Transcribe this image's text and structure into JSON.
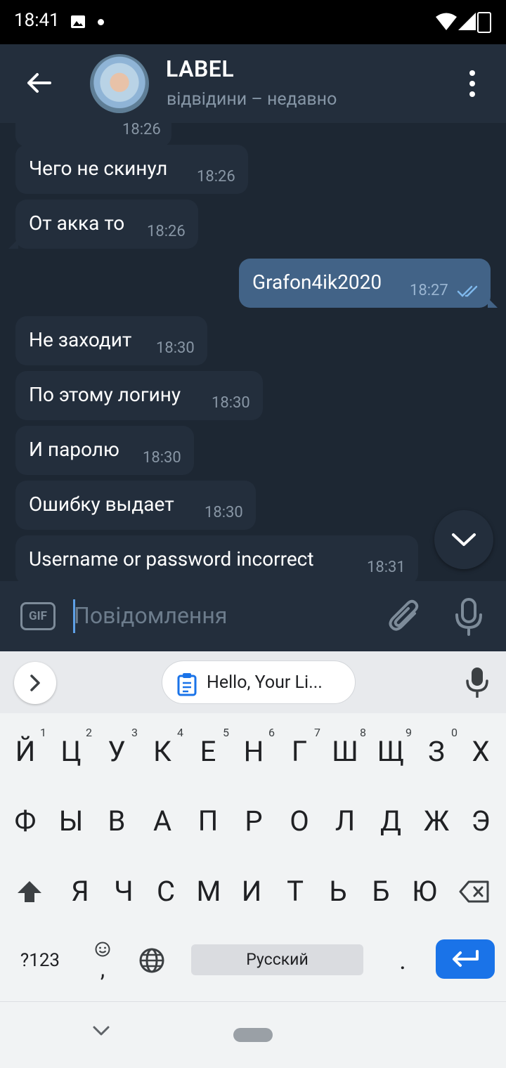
{
  "status_bar": {
    "time": "18:41"
  },
  "header": {
    "title": "LABEL",
    "status": "відвідини – недавно"
  },
  "messages": [
    {
      "text": "Чего не скинул",
      "time": "18:26",
      "direction": "in"
    },
    {
      "text": "От акка то",
      "time": "18:26",
      "direction": "in"
    },
    {
      "text": "Grafon4ik2020",
      "time": "18:27",
      "direction": "out",
      "read": true
    },
    {
      "text": "Не заходит",
      "time": "18:30",
      "direction": "in"
    },
    {
      "text": "По этому логину",
      "time": "18:30",
      "direction": "in"
    },
    {
      "text": "И паролю",
      "time": "18:30",
      "direction": "in"
    },
    {
      "text": "Ошибку выдает",
      "time": "18:30",
      "direction": "in"
    },
    {
      "text": "Username or password incorrect",
      "time": "18:31",
      "direction": "in"
    }
  ],
  "partial_message": {
    "time": "18:26"
  },
  "composer": {
    "gif_label": "GIF",
    "placeholder": "Повідомлення"
  },
  "keyboard": {
    "clipboard_chip": "Hello, Your Li...",
    "row1": [
      "Й",
      "Ц",
      "У",
      "К",
      "Е",
      "Н",
      "Г",
      "Ш",
      "Щ",
      "З",
      "Х"
    ],
    "row1_hints": [
      "1",
      "2",
      "3",
      "4",
      "5",
      "6",
      "7",
      "8",
      "9",
      "0"
    ],
    "row2": [
      "Ф",
      "Ы",
      "В",
      "А",
      "П",
      "Р",
      "О",
      "Л",
      "Д",
      "Ж",
      "Э"
    ],
    "row3": [
      "Я",
      "Ч",
      "С",
      "М",
      "И",
      "Т",
      "Ь",
      "Б",
      "Ю"
    ],
    "symbols_key": "?123",
    "comma_key": ",",
    "space_label": "Русский",
    "period_key": "."
  },
  "colors": {
    "accent": "#1a73e8",
    "outgoing_bubble": "#426387",
    "incoming_bubble": "#232e3c",
    "chat_bg": "#1d2733"
  }
}
